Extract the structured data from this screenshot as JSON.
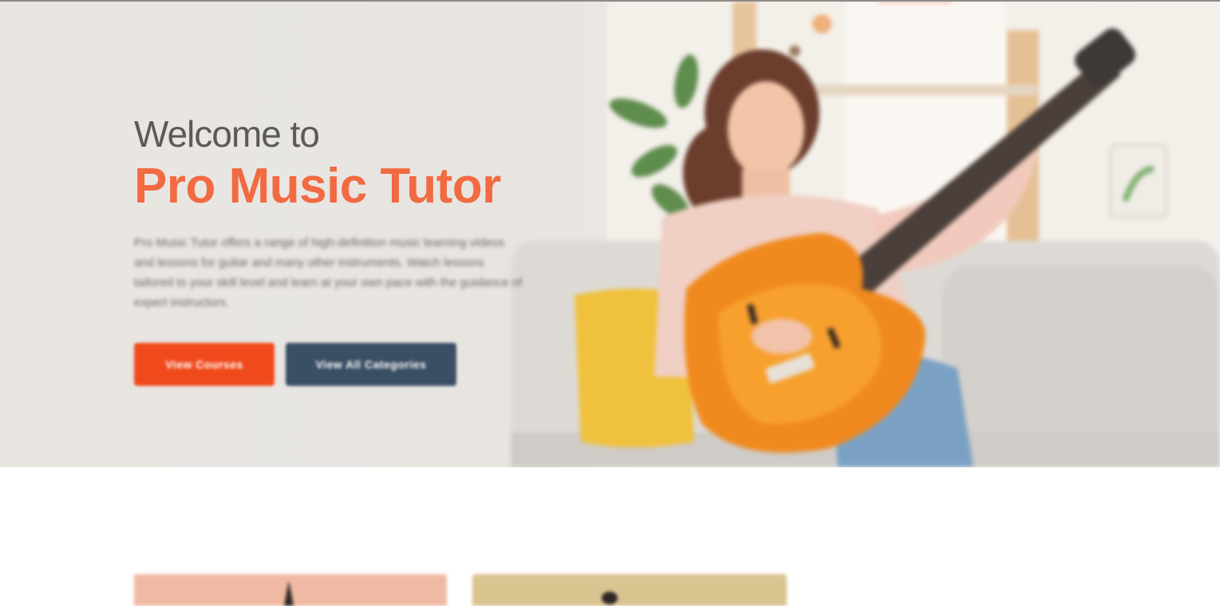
{
  "hero": {
    "welcome": "Welcome to",
    "title": "Pro Music Tutor",
    "description": "Pro Music Tutor offers a range of high-definition music learning videos and lessons for guitar and many other instruments. Watch lessons tailored to your skill level and learn at your own pace with the guidance of expert instructors.",
    "primary_button": "View Courses",
    "secondary_button": "View All Categories",
    "image_alt": "Woman playing an orange electric guitar on a sofa"
  },
  "colors": {
    "accent": "#f26a42",
    "primary_button": "#f04a1c",
    "secondary_button": "#3a4e64",
    "hero_bg": "#e9e6e2"
  }
}
